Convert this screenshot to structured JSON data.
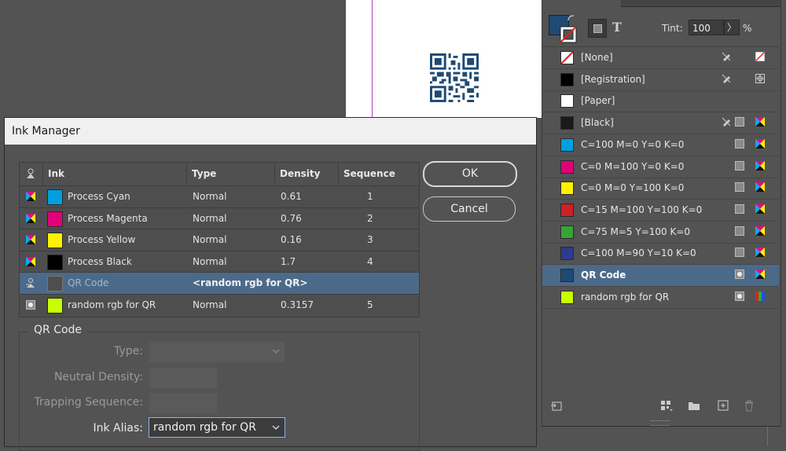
{
  "swatches_panel": {
    "tint_label": "Tint:",
    "tint_value": "100",
    "tint_stepper": "〉",
    "tint_unit": "%",
    "type_glyph": "T",
    "colors": {
      "fill": "#1e4a73",
      "accent_selected_row": "#4b6a8a"
    },
    "items": [
      {
        "label": "[None]",
        "chip": "none",
        "icons": [
          "non-editable-pencil-icon",
          "none-swatch-icon"
        ]
      },
      {
        "label": "[Registration]",
        "chip": "#000000",
        "icons": [
          "non-editable-pencil-icon",
          "registration-mark-icon"
        ]
      },
      {
        "label": "[Paper]",
        "chip": "#ffffff",
        "icons": []
      },
      {
        "label": "[Black]",
        "chip": "#1a1a1a",
        "icons": [
          "non-editable-pencil-icon",
          "process-type-icon",
          "cmyk-mode-icon"
        ]
      },
      {
        "label": "C=100 M=0 Y=0 K=0",
        "chip": "#00a0e0",
        "icons": [
          "process-type-icon",
          "cmyk-mode-icon"
        ]
      },
      {
        "label": "C=0 M=100 Y=0 K=0",
        "chip": "#e0007a",
        "icons": [
          "process-type-icon",
          "cmyk-mode-icon"
        ]
      },
      {
        "label": "C=0 M=0 Y=100 K=0",
        "chip": "#fff200",
        "icons": [
          "process-type-icon",
          "cmyk-mode-icon"
        ]
      },
      {
        "label": "C=15 M=100 Y=100 K=0",
        "chip": "#d01f25",
        "icons": [
          "process-type-icon",
          "cmyk-mode-icon"
        ]
      },
      {
        "label": "C=75 M=5 Y=100 K=0",
        "chip": "#3aa335",
        "icons": [
          "process-type-icon",
          "cmyk-mode-icon"
        ]
      },
      {
        "label": "C=100 M=90 Y=10 K=0",
        "chip": "#2e3a8c",
        "icons": [
          "process-type-icon",
          "cmyk-mode-icon"
        ]
      },
      {
        "label": "QR Code",
        "chip": "#1e4a73",
        "selected": true,
        "icons": [
          "spot-type-icon",
          "cmyk-mode-icon"
        ]
      },
      {
        "label": "random rgb for QR",
        "chip": "#c8ff00",
        "icons": [
          "spot-type-icon",
          "rgb-mode-icon"
        ]
      }
    ]
  },
  "ink_manager": {
    "title": "Ink Manager",
    "columns": [
      "Ink",
      "Type",
      "Density",
      "Sequence"
    ],
    "rows": [
      {
        "name": "Process Cyan",
        "type": "Normal",
        "density": "0.61",
        "sequence": "1",
        "chip": "#00a0e0",
        "icon": "process-ink-icon"
      },
      {
        "name": "Process Magenta",
        "type": "Normal",
        "density": "0.76",
        "sequence": "2",
        "chip": "#e0007a",
        "icon": "process-ink-icon"
      },
      {
        "name": "Process Yellow",
        "type": "Normal",
        "density": "0.16",
        "sequence": "3",
        "chip": "#fff200",
        "icon": "process-ink-icon"
      },
      {
        "name": "Process Black",
        "type": "Normal",
        "density": "1.7",
        "sequence": "4",
        "chip": "#000000",
        "icon": "process-ink-icon"
      },
      {
        "name": "QR Code",
        "type": "<random rgb for QR>",
        "density": "",
        "sequence": "",
        "chip": "#4e4e4e",
        "icon": "ink-alias-icon",
        "selected": true
      },
      {
        "name": "random rgb for QR",
        "type": "Normal",
        "density": "0.3157",
        "sequence": "5",
        "chip": "#c8ff00",
        "icon": "spot-ink-icon"
      }
    ],
    "ok_label": "OK",
    "cancel_label": "Cancel",
    "group_title": "QR Code",
    "fields": {
      "type_label": "Type:",
      "neutral_density_label": "Neutral Density:",
      "trapping_sequence_label": "Trapping Sequence:",
      "ink_alias_label": "Ink Alias:",
      "ink_alias_value": "random rgb for QR"
    }
  }
}
